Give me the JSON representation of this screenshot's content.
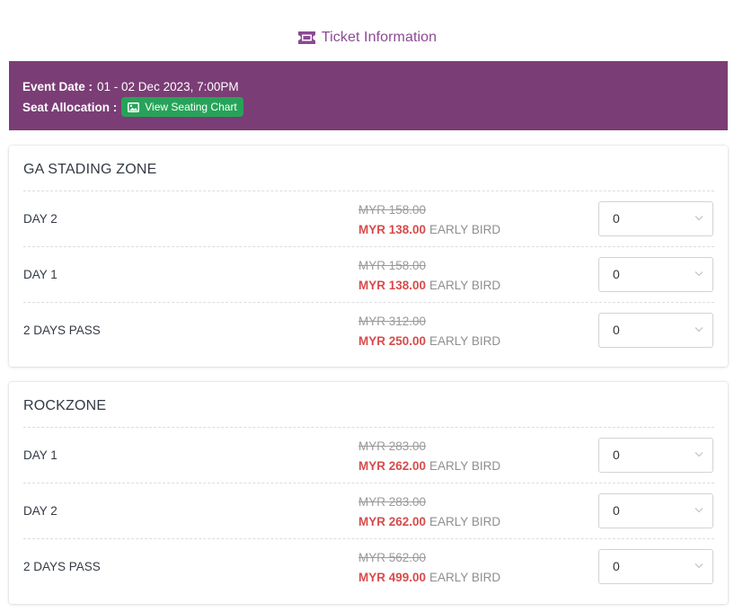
{
  "header": {
    "title": "Ticket Information",
    "icon": "ticket-icon",
    "title_color": "#8a4a93"
  },
  "event": {
    "date_label": "Event Date :",
    "date_value": "01 - 02 Dec 2023, 7:00PM",
    "seat_label": "Seat Allocation :",
    "seating_button_label": "View Seating Chart",
    "seating_button_icon": "image-icon",
    "banner_color": "#7b3d75",
    "button_color": "#27a359"
  },
  "zones": [
    {
      "name": "GA STADING ZONE",
      "tickets": [
        {
          "name": "DAY 2",
          "original_price": "MYR 158.00",
          "price": "MYR 138.00",
          "tag": "EARLY BIRD",
          "quantity": "0"
        },
        {
          "name": "DAY 1",
          "original_price": "MYR 158.00",
          "price": "MYR 138.00",
          "tag": "EARLY BIRD",
          "quantity": "0"
        },
        {
          "name": "2 DAYS PASS",
          "original_price": "MYR 312.00",
          "price": "MYR 250.00",
          "tag": "EARLY BIRD",
          "quantity": "0"
        }
      ]
    },
    {
      "name": "ROCKZONE",
      "tickets": [
        {
          "name": "DAY 1",
          "original_price": "MYR 283.00",
          "price": "MYR 262.00",
          "tag": "EARLY BIRD",
          "quantity": "0"
        },
        {
          "name": "DAY 2",
          "original_price": "MYR 283.00",
          "price": "MYR 262.00",
          "tag": "EARLY BIRD",
          "quantity": "0"
        },
        {
          "name": "2 DAYS PASS",
          "original_price": "MYR 562.00",
          "price": "MYR 499.00",
          "tag": "EARLY BIRD",
          "quantity": "0"
        }
      ]
    }
  ],
  "colors": {
    "price_red": "#d84b4b",
    "strike_gray": "#9a9a9a"
  }
}
